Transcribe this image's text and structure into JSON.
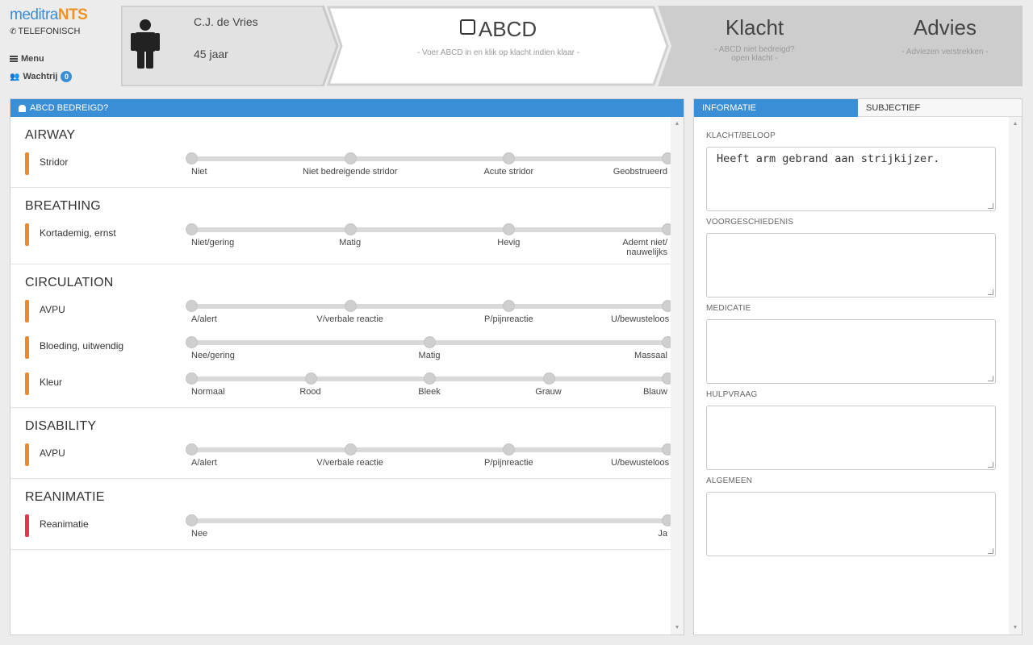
{
  "brand": {
    "part1": "meditra",
    "part2": "NTS"
  },
  "channel": "TELEFONISCH",
  "nav": {
    "menu_label": "Menu",
    "queue_label": "Wachtrij",
    "queue_count": "0"
  },
  "patient": {
    "name": "C.J. de Vries",
    "age": "45 jaar"
  },
  "steps": [
    {
      "title": "ABCD",
      "subtitle": "- Voer ABCD in en klik op klacht indien klaar -"
    },
    {
      "title": "Klacht",
      "subtitle_line1": "- ABCD niet bedreigd?",
      "subtitle_line2": "open klacht -"
    },
    {
      "title": "Advies",
      "subtitle": "- Adviezen verstrekken -"
    }
  ],
  "left_panel": {
    "header": "ABCD BEDREIGD?",
    "sections": [
      {
        "title": "AIRWAY",
        "rows": [
          {
            "label": "Stridor",
            "flag": "orange",
            "ticks": [
              "Niet",
              "Niet bedreigende stridor",
              "Acute stridor",
              "Geobstrueerd"
            ]
          }
        ]
      },
      {
        "title": "BREATHING",
        "rows": [
          {
            "label": "Kortademig, ernst",
            "flag": "orange",
            "ticks": [
              "Niet/gering",
              "Matig",
              "Hevig",
              "Ademt niet/ nauwelijks"
            ]
          }
        ]
      },
      {
        "title": "CIRCULATION",
        "rows": [
          {
            "label": "AVPU",
            "flag": "orange",
            "ticks": [
              "A/alert",
              "V/verbale reactie",
              "P/pijnreactie",
              "U/bewusteloos"
            ]
          },
          {
            "label": "Bloeding, uitwendig",
            "flag": "orange",
            "ticks": [
              "Nee/gering",
              "Matig",
              "Massaal"
            ]
          },
          {
            "label": "Kleur",
            "flag": "orange",
            "ticks": [
              "Normaal",
              "Rood",
              "Bleek",
              "Grauw",
              "Blauw"
            ]
          }
        ]
      },
      {
        "title": "DISABILITY",
        "rows": [
          {
            "label": "AVPU",
            "flag": "orange",
            "ticks": [
              "A/alert",
              "V/verbale reactie",
              "P/pijnreactie",
              "U/bewusteloos"
            ]
          }
        ]
      },
      {
        "title": "REANIMATIE",
        "rows": [
          {
            "label": "Reanimatie",
            "flag": "red",
            "ticks": [
              "Nee",
              "Ja"
            ]
          }
        ]
      }
    ]
  },
  "right_panel": {
    "tabs": [
      "INFORMATIE",
      "SUBJECTIEF"
    ],
    "fields": [
      {
        "label": "KLACHT/BELOOP",
        "value": "Heeft arm gebrand aan strijkijzer."
      },
      {
        "label": "VOORGESCHIEDENIS",
        "value": ""
      },
      {
        "label": "MEDICATIE",
        "value": ""
      },
      {
        "label": "HULPVRAAG",
        "value": ""
      },
      {
        "label": "ALGEMEEN",
        "value": ""
      }
    ]
  },
  "colors": {
    "accent": "#3a8ed6",
    "flag_orange": "#f0892b",
    "flag_red": "#e8334f",
    "logo_orange": "#f0921f"
  }
}
